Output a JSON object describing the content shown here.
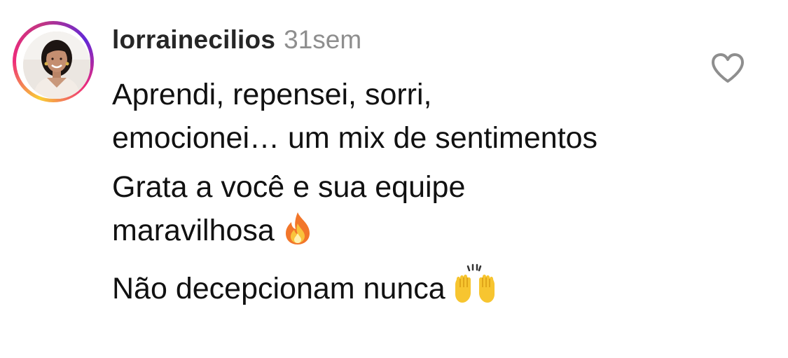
{
  "comment": {
    "username": "lorrainecilios",
    "timestamp": "31sem",
    "paragraphs": [
      {
        "text": "Aprendi, repensei, sorri, emocionei… um mix de sentimentos",
        "emoji": ""
      },
      {
        "text": "Grata a você e sua equipe maravilhosa",
        "emoji": "fire-emoji"
      },
      {
        "text": "Não decepcionam nunca",
        "emoji": "raising-hands-emoji"
      }
    ],
    "avatar": "profile-photo",
    "like_icon": "heart-outline-icon"
  },
  "colors": {
    "username": "#262626",
    "timestamp": "#8e8e8e",
    "text": "#111111",
    "like_icon": "#8e8e8e",
    "story_ring_start": "#f9ce34",
    "story_ring_mid": "#ee2a7b",
    "story_ring_end": "#6228d7"
  }
}
